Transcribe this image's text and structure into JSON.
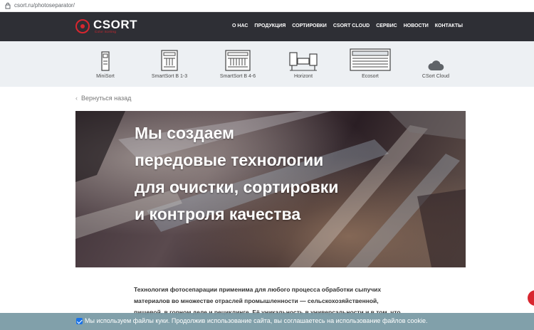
{
  "browser": {
    "url": "csort.ru/photoseparator/"
  },
  "header": {
    "logo": {
      "name": "CSORT",
      "tagline": "Color Sorting"
    },
    "menu": [
      "О НАС",
      "ПРОДУКЦИЯ",
      "СОРТИРОВКИ",
      "CSORT CLOUD",
      "СЕРВИС",
      "НОВОСТИ",
      "КОНТАКТЫ"
    ]
  },
  "products": [
    {
      "label": "MiniSort",
      "icon": "minisort-machine-icon"
    },
    {
      "label": "SmartSort B 1-3",
      "icon": "smartsort-b13-machine-icon"
    },
    {
      "label": "SmartSort B 4-6",
      "icon": "smartsort-b46-machine-icon"
    },
    {
      "label": "Horizont",
      "icon": "horizont-machine-icon"
    },
    {
      "label": "Ecosort",
      "icon": "ecosort-machine-icon"
    },
    {
      "label": "CSort Cloud",
      "icon": "cloud-icon"
    }
  ],
  "back_link": {
    "label": "Вернуться назад"
  },
  "hero": {
    "lines": [
      "Мы создаем",
      "передовые технологии",
      "для очистки, сортировки",
      "и контроля качества"
    ]
  },
  "article": {
    "lines": [
      "Технология фотосепарации применима для любого процесса обработки сыпучих",
      "материалов во множестве отраслей промышленности — сельскохозяйственной,",
      "пищевой, в горном деле и рециклинге. Её уникальность в универсальности и в том, что"
    ]
  },
  "cookie_banner": {
    "text": "Мы используем файлы куки. Продолжив использование сайта, вы соглашаетесь на использование файлов cookie.",
    "checked": true
  },
  "colors": {
    "brand_red": "#d8262f",
    "nav_bg": "#2e2f35",
    "products_bg": "#edf0f3",
    "cookie_bg": "#7a9ba5"
  }
}
